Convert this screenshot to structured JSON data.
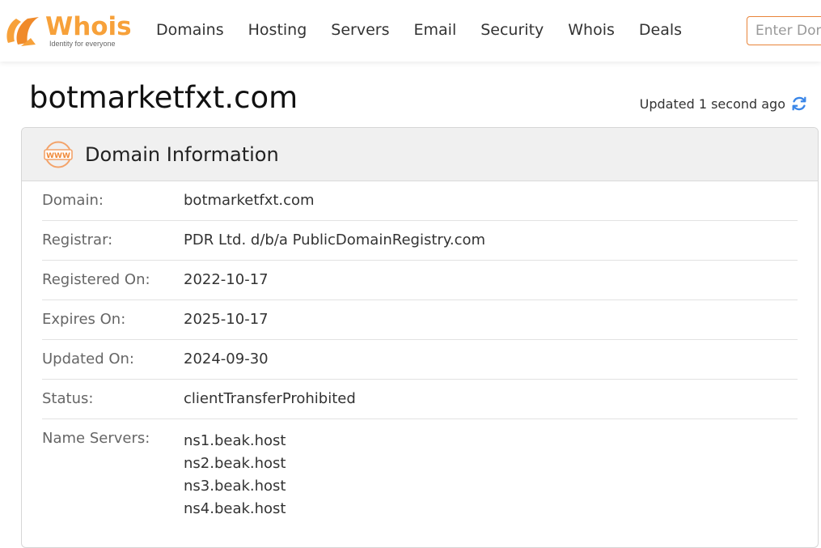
{
  "brand": {
    "name": "Whois",
    "tagline": "Identity for everyone",
    "color": "#f7a13a"
  },
  "nav": {
    "items": [
      "Domains",
      "Hosting",
      "Servers",
      "Email",
      "Security",
      "Whois",
      "Deals"
    ]
  },
  "search": {
    "placeholder": "Enter Domain"
  },
  "page": {
    "domain": "botmarketfxt.com",
    "updated_text": "Updated 1 second ago"
  },
  "card": {
    "title": "Domain Information",
    "rows": [
      {
        "label": "Domain:",
        "value": "botmarketfxt.com"
      },
      {
        "label": "Registrar:",
        "value": "PDR Ltd. d/b/a PublicDomainRegistry.com"
      },
      {
        "label": "Registered On:",
        "value": "2022-10-17"
      },
      {
        "label": "Expires On:",
        "value": "2025-10-17"
      },
      {
        "label": "Updated On:",
        "value": "2024-09-30"
      },
      {
        "label": "Status:",
        "value": "clientTransferProhibited"
      }
    ],
    "name_servers": {
      "label": "Name Servers:",
      "values": [
        "ns1.beak.host",
        "ns2.beak.host",
        "ns3.beak.host",
        "ns4.beak.host"
      ]
    }
  },
  "icons": {
    "refresh": "refresh-icon",
    "www": "www-icon",
    "logo": "whois-logo-icon"
  }
}
